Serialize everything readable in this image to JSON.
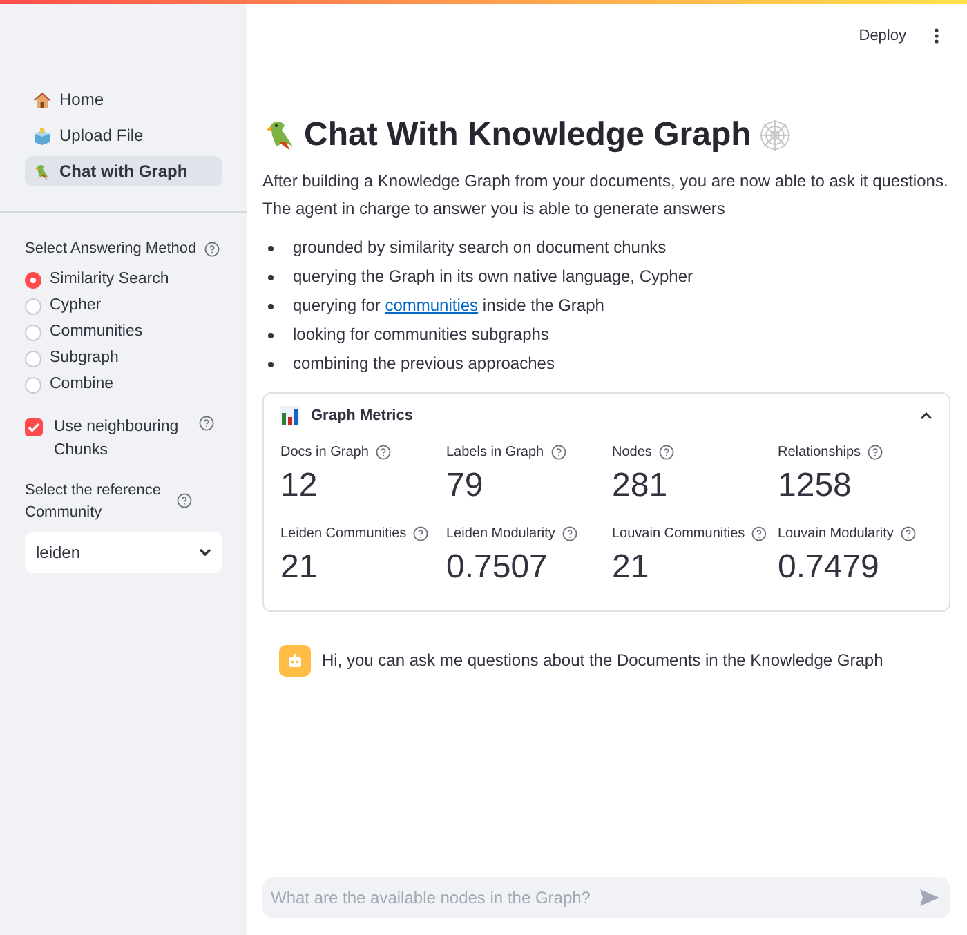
{
  "header": {
    "deploy": "Deploy"
  },
  "sidebar": {
    "nav": [
      {
        "label": "Home",
        "selected": false
      },
      {
        "label": "Upload File",
        "selected": false
      },
      {
        "label": "Chat with Graph",
        "selected": true
      }
    ],
    "method": {
      "label": "Select Answering Method",
      "options": [
        {
          "label": "Similarity Search",
          "selected": true
        },
        {
          "label": "Cypher",
          "selected": false
        },
        {
          "label": "Communities",
          "selected": false
        },
        {
          "label": "Subgraph",
          "selected": false
        },
        {
          "label": "Combine",
          "selected": false
        }
      ]
    },
    "neighbours": {
      "label": "Use neighbouring Chunks",
      "checked": true
    },
    "community": {
      "label": "Select the reference Community",
      "value": "leiden"
    }
  },
  "title": "Chat With Knowledge Graph",
  "intro": [
    "After building a Knowledge Graph from your documents, you are now able to ask it questions.",
    "The agent in charge to answer you is able to generate answers"
  ],
  "bullets": [
    {
      "parts": [
        {
          "text": "grounded by similarity search on document chunks"
        }
      ]
    },
    {
      "parts": [
        {
          "text": "querying the Graph in its own native language, Cypher"
        }
      ]
    },
    {
      "parts": [
        {
          "text": "querying for "
        },
        {
          "text": "communities",
          "link": true
        },
        {
          "text": " inside the Graph"
        }
      ]
    },
    {
      "parts": [
        {
          "text": "looking for communities subgraphs"
        }
      ]
    },
    {
      "parts": [
        {
          "text": "combining the previous approaches"
        }
      ]
    }
  ],
  "metrics": {
    "title": "Graph Metrics",
    "expanded": true,
    "items": [
      {
        "label": "Docs in Graph",
        "value": "12"
      },
      {
        "label": "Labels in Graph",
        "value": "79"
      },
      {
        "label": "Nodes",
        "value": "281"
      },
      {
        "label": "Relationships",
        "value": "1258"
      },
      {
        "label": "Leiden Communities",
        "value": "21"
      },
      {
        "label": "Leiden Modularity",
        "value": "0.7507"
      },
      {
        "label": "Louvain Communities",
        "value": "21"
      },
      {
        "label": "Louvain Modularity",
        "value": "0.7479"
      }
    ]
  },
  "messages": [
    {
      "kind": "bot",
      "text": "Hi, you can ask me questions about the Documents in the Knowledge Graph"
    }
  ],
  "chat_input": {
    "placeholder": "What are the available nodes in the Graph?"
  }
}
